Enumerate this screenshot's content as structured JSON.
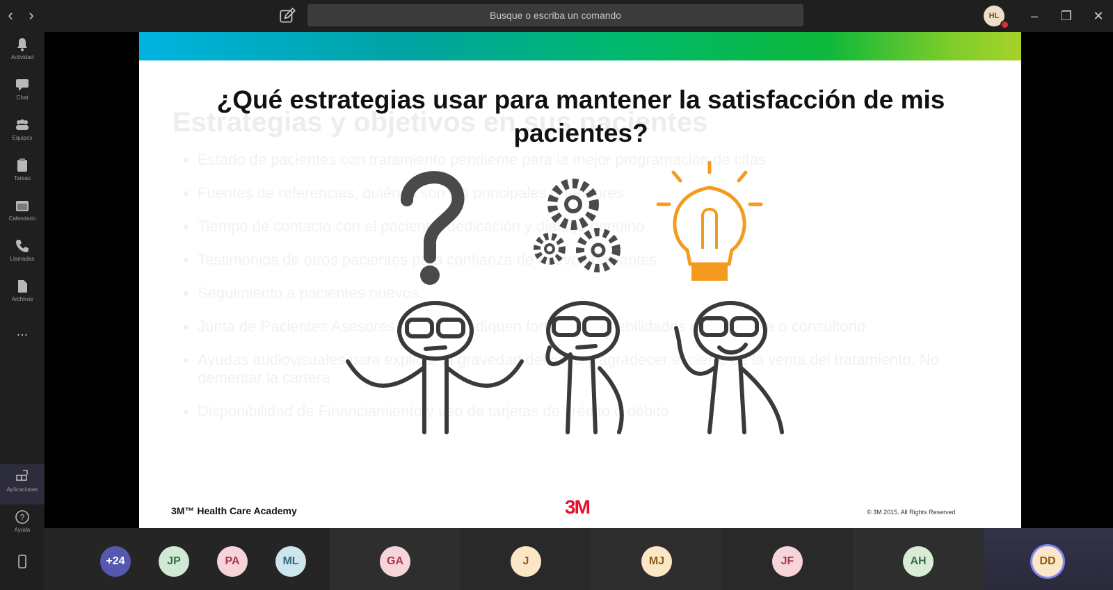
{
  "titlebar": {
    "search_placeholder": "Busque o escriba un comando",
    "user_initials": "HL"
  },
  "rail": [
    {
      "label": "Actividad",
      "icon": "bell-icon"
    },
    {
      "label": "Chat",
      "icon": "chat-icon"
    },
    {
      "label": "Equipos",
      "icon": "teams-icon"
    },
    {
      "label": "Tareas",
      "icon": "tasks-icon"
    },
    {
      "label": "Calendario",
      "icon": "calendar-icon"
    },
    {
      "label": "Llamadas",
      "icon": "phone-icon"
    },
    {
      "label": "Archivos",
      "icon": "files-icon"
    },
    {
      "label": "...",
      "icon": "more-icon"
    },
    {
      "label": "Aplicaciones",
      "icon": "apps-icon"
    },
    {
      "label": "Ayuda",
      "icon": "help-icon"
    }
  ],
  "slide": {
    "title": "¿Qué estrategias usar para mantener la satisfacción de mis pacientes?",
    "faded_heading": "Estrategias y objetivos en sus pacientes",
    "faded_bullets": [
      "Estado de pacientes con tratamiento pendiente para la mejor programación de citas",
      "Fuentes de referencias, quiénes son los principales referidores",
      "Tiempo de contacto con el paciente, dedicación y diálogo genuino",
      "Testimonios de otros pacientes para confianza de nuevos pacientes",
      "Seguimiento a pacientes nuevos",
      "Junta de Pacientes Asesores para que indiquen fortalezas y debilidades de la Clínica o consultorio",
      "Ayudas audiovisuales para explicar la gravedad del caso y agradecer el cierre de la venta del tratamiento. No demeritar la cartera",
      "Disponibilidad de Financiamiento y uso de tarjetas de crédito o débito"
    ],
    "footer_brand": "3M™ Health Care Academy",
    "logo_text": "3M",
    "copyright": "© 3M 2015. All Rights Reserved",
    "colors": {
      "bar_start": "#00b4e0",
      "bar_end": "#a6d22a",
      "bulb": "#f39a1f",
      "logo": "#e5112d"
    }
  },
  "participants": [
    {
      "initials": "+24",
      "bg": "#5558af",
      "fg": "#ffffff"
    },
    {
      "initials": "JP",
      "bg": "#cfe9d4",
      "fg": "#3b6b48"
    },
    {
      "initials": "PA",
      "bg": "#f7d4da",
      "fg": "#a8364e"
    },
    {
      "initials": "ML",
      "bg": "#cde6ee",
      "fg": "#2e6a80"
    },
    {
      "initials": "GA",
      "bg": "#f7d4da",
      "fg": "#a8364e"
    },
    {
      "initials": "J",
      "bg": "#fbe6c5",
      "fg": "#8a5a16"
    },
    {
      "initials": "MJ",
      "bg": "#fbe6c5",
      "fg": "#8a5a16"
    },
    {
      "initials": "JF",
      "bg": "#f7d4da",
      "fg": "#a8364e"
    },
    {
      "initials": "AH",
      "bg": "#d9ecd6",
      "fg": "#3b6b48"
    },
    {
      "initials": "DD",
      "bg": "#fbe6c5",
      "fg": "#8a5a16"
    }
  ]
}
